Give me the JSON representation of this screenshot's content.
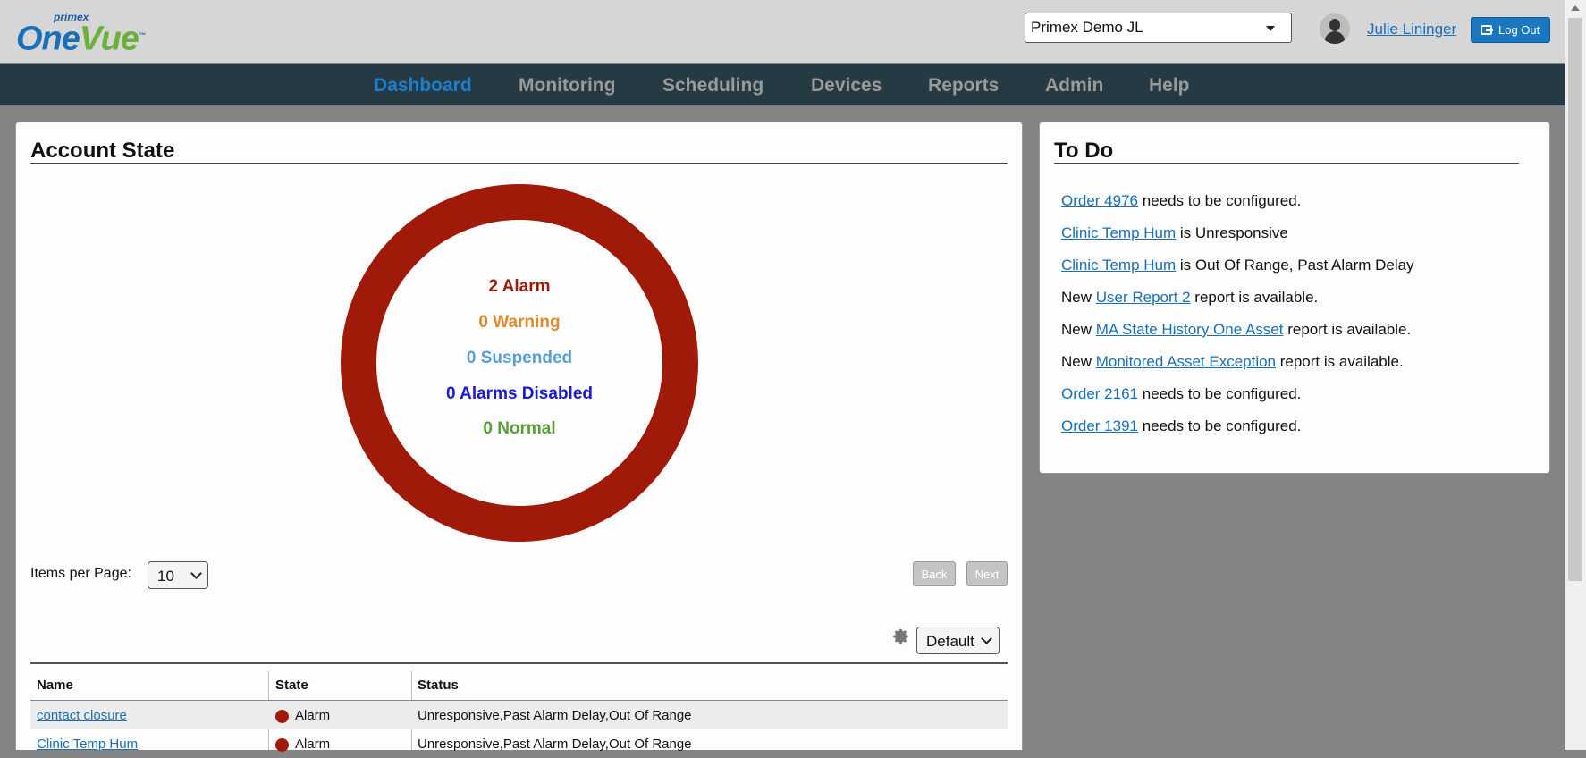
{
  "header": {
    "logo_brand": "primex",
    "logo_one": "One",
    "logo_vue": "Vue",
    "logo_tm": "™",
    "account_select_value": "Primex Demo JL",
    "user_name": "Julie Lininger",
    "logout_label": "Log Out"
  },
  "nav": {
    "items": [
      {
        "label": "Dashboard",
        "active": true
      },
      {
        "label": "Monitoring",
        "active": false
      },
      {
        "label": "Scheduling",
        "active": false
      },
      {
        "label": "Devices",
        "active": false
      },
      {
        "label": "Reports",
        "active": false
      },
      {
        "label": "Admin",
        "active": false
      },
      {
        "label": "Help",
        "active": false
      }
    ]
  },
  "account_state": {
    "title": "Account State",
    "donut_color": "#a01a0a",
    "states": [
      {
        "label": "2 Alarm",
        "color": "#9a1a0a"
      },
      {
        "label": "0 Warning",
        "color": "#e08a2e"
      },
      {
        "label": "0 Suspended",
        "color": "#5a9ed8"
      },
      {
        "label": "0 Alarms Disabled",
        "color": "#1a1ad0"
      },
      {
        "label": "0 Normal",
        "color": "#5a9e3a"
      }
    ],
    "items_per_page_label": "Items per Page:",
    "items_per_page_value": "10",
    "back_label": "Back",
    "next_label": "Next",
    "view_select_value": "Default",
    "table": {
      "columns": [
        "Name",
        "State",
        "Status"
      ],
      "rows": [
        {
          "name": "contact closure",
          "state": "Alarm",
          "status": "Unresponsive,Past Alarm Delay,Out Of Range"
        },
        {
          "name": "Clinic Temp Hum",
          "state": "Alarm",
          "status": "Unresponsive,Past Alarm Delay,Out Of Range"
        }
      ]
    }
  },
  "todo": {
    "title": "To Do",
    "items": [
      {
        "pre": "",
        "link": "Order 4976",
        "post": " needs to be configured."
      },
      {
        "pre": "",
        "link": "Clinic Temp Hum",
        "post": " is Unresponsive"
      },
      {
        "pre": "",
        "link": "Clinic Temp Hum",
        "post": " is Out Of Range, Past Alarm Delay"
      },
      {
        "pre": "New ",
        "link": "User Report 2",
        "post": " report is available."
      },
      {
        "pre": "New ",
        "link": "MA State History One Asset",
        "post": " report is available."
      },
      {
        "pre": "New ",
        "link": "Monitored Asset Exception",
        "post": " report is available."
      },
      {
        "pre": "",
        "link": "Order 2161",
        "post": " needs to be configured."
      },
      {
        "pre": "",
        "link": "Order 1391",
        "post": " needs to be configured."
      }
    ]
  }
}
